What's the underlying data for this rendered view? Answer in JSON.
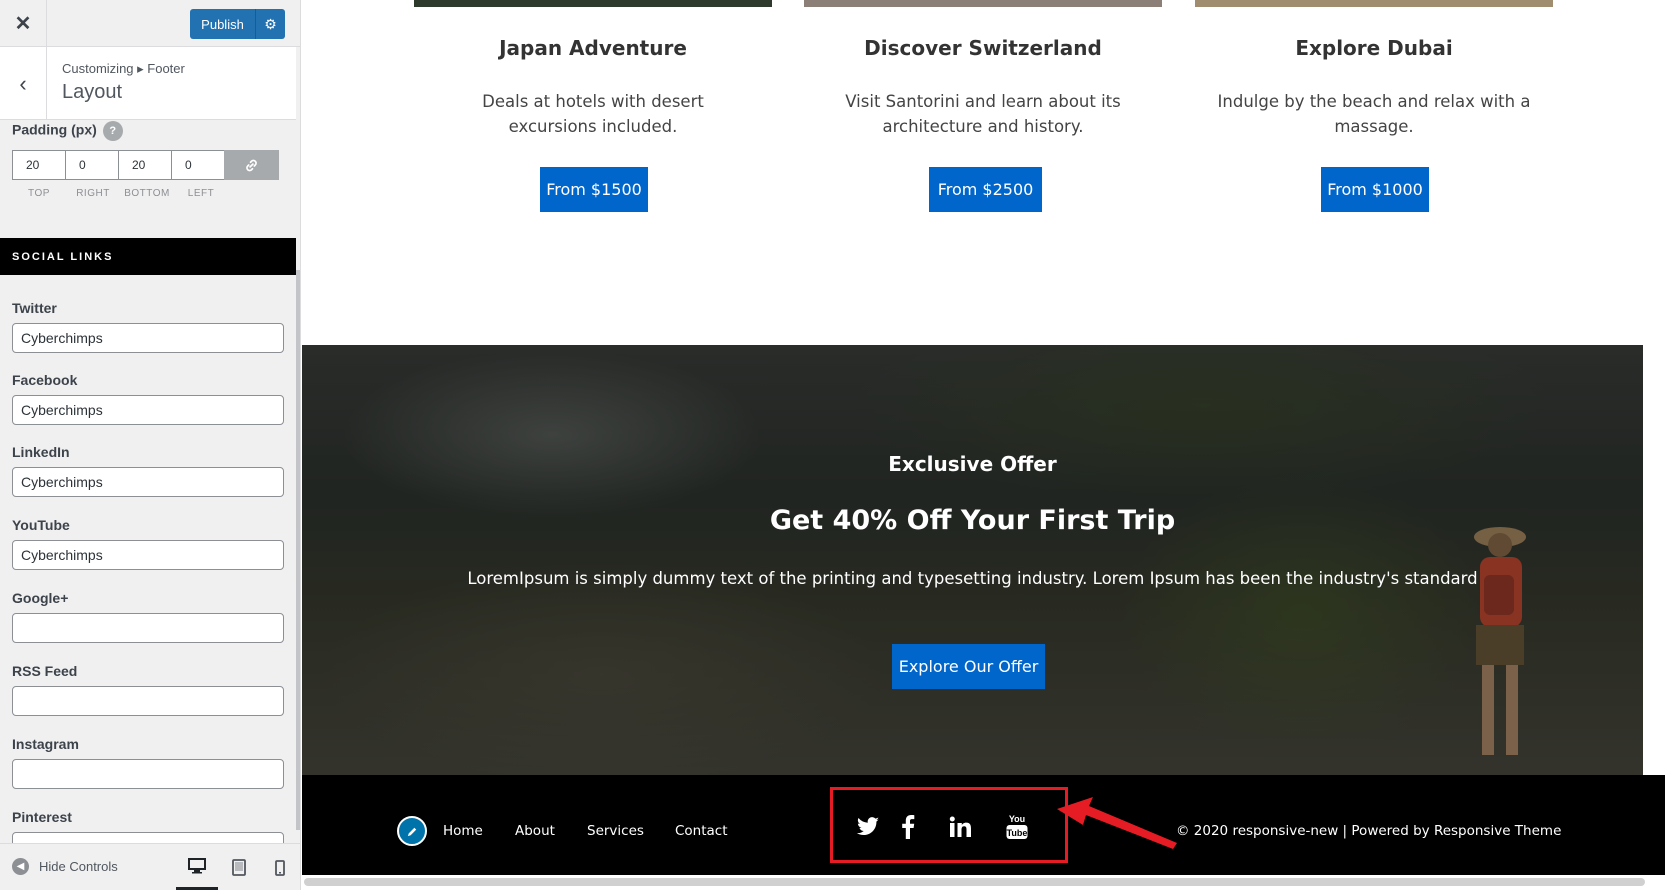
{
  "customizer": {
    "publish_label": "Publish",
    "breadcrumb": "Customizing ▸ Footer",
    "section_title": "Layout",
    "padding": {
      "label": "Padding (px)",
      "values": [
        "20",
        "0",
        "20",
        "0"
      ],
      "labels": [
        "TOP",
        "RIGHT",
        "BOTTOM",
        "LEFT"
      ]
    },
    "social_section_title": "SOCIAL LINKS",
    "fields": [
      {
        "label": "Twitter",
        "value": "Cyberchimps"
      },
      {
        "label": "Facebook",
        "value": "Cyberchimps"
      },
      {
        "label": "LinkedIn",
        "value": "Cyberchimps"
      },
      {
        "label": "YouTube",
        "value": "Cyberchimps"
      },
      {
        "label": "Google+",
        "value": ""
      },
      {
        "label": "RSS Feed",
        "value": ""
      },
      {
        "label": "Instagram",
        "value": ""
      },
      {
        "label": "Pinterest",
        "value": ""
      }
    ],
    "hide_controls_label": "Hide Controls",
    "icons": {
      "close": "✕",
      "back": "‹",
      "settings": "⚙",
      "link": "🔗",
      "help": "?",
      "hide": "◀"
    }
  },
  "preview": {
    "cards": [
      {
        "title": "Japan Adventure",
        "desc_line1": "Deals at hotels with desert",
        "desc_line2": "excursions included.",
        "button": "From $1500",
        "strip_color": "#2e3a2c"
      },
      {
        "title": "Discover Switzerland",
        "desc_line1": "Visit Santorini and learn about its",
        "desc_line2": "architecture and history.",
        "button": "From $2500",
        "strip_color": "#8c7f78"
      },
      {
        "title": "Explore Dubai",
        "desc_line1": "Indulge by the beach and relax with a",
        "desc_line2": "massage.",
        "button": "From $1000",
        "strip_color": "#a08c6e"
      }
    ],
    "hero": {
      "kicker": "Exclusive Offer",
      "title": "Get 40% Off Your First Trip",
      "description": "LoremIpsum is simply dummy text of the printing and typesetting industry. Lorem Ipsum has been the industry's standard",
      "button": "Explore Our Offer"
    },
    "footer": {
      "nav": [
        "Home",
        "About",
        "Services",
        "Contact"
      ],
      "social_icons": [
        "twitter-icon",
        "facebook-icon",
        "linkedin-icon",
        "youtube-icon"
      ],
      "copyright_prefix": "© 2020 responsive-new | Powered by ",
      "copyright_link": "Responsive Theme"
    }
  },
  "colors": {
    "wp_blue": "#2271b1",
    "button_blue": "#0066cc",
    "highlight_red": "#e51c23"
  }
}
